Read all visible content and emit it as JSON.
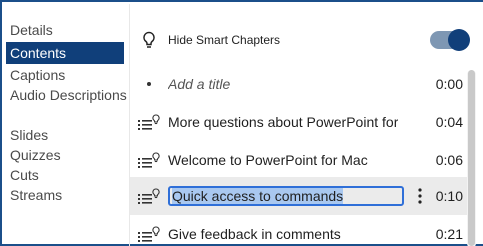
{
  "sidebar": {
    "items": [
      {
        "label": "Details"
      },
      {
        "label": "Contents"
      },
      {
        "label": "Captions"
      },
      {
        "label": "Audio Descriptions"
      },
      {
        "label": "Slides"
      },
      {
        "label": "Quizzes"
      },
      {
        "label": "Cuts"
      },
      {
        "label": "Streams"
      }
    ],
    "active": "Contents"
  },
  "settings": {
    "hide_smart_chapters_label": "Hide Smart Chapters",
    "hide_smart_chapters_on": true
  },
  "chapters": [
    {
      "title": "Add a title",
      "time": "0:00",
      "is_placeholder": true
    },
    {
      "title": "More questions about PowerPoint for",
      "time": "0:04"
    },
    {
      "title": "Welcome to PowerPoint for Mac",
      "time": "0:06"
    },
    {
      "title": "Quick access to commands",
      "time": "0:10",
      "editing": true
    },
    {
      "title": "Give feedback in comments",
      "time": "0:21"
    }
  ],
  "colors": {
    "accent": "#103f7a",
    "selection": "#a9c8f0",
    "focus": "#2f6fd8",
    "row_selected": "#ebebeb"
  }
}
